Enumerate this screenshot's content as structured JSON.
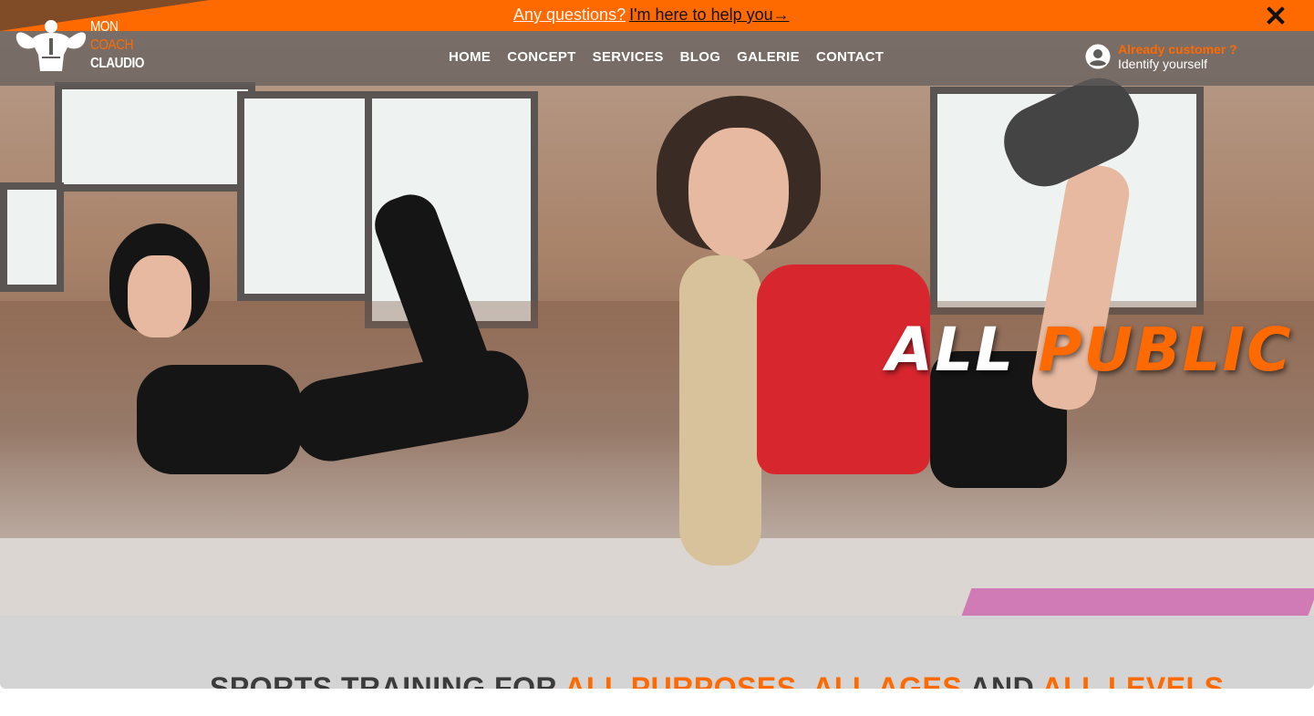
{
  "announcement": {
    "question": "Any questions?",
    "help_link": "I'm here to help you→"
  },
  "logo": {
    "line1": "MON",
    "line2": "COACH",
    "line3": "CLAUDIO"
  },
  "nav": {
    "items": [
      "HOME",
      "CONCEPT",
      "SERVICES",
      "BLOG",
      "GALERIE",
      "CONTACT"
    ]
  },
  "account": {
    "prompt": "Already customer ?",
    "action": "Identify yourself"
  },
  "hero": {
    "headline_white": "ALL",
    "headline_orange": "PUBLIC"
  },
  "tagline": {
    "part1": "SPORTS TRAINING FOR",
    "part2": "ALL PURPOSES, ALL AGES",
    "part3": "AND",
    "part4": "ALL LEVELS"
  },
  "colors": {
    "accent": "#ff6a00",
    "nav_overlay": "#5f5c5a",
    "band": "#d4d4d4"
  },
  "icons": {
    "close": "close-icon",
    "account": "user-circle-icon",
    "logo": "bodybuilder-logo-icon"
  }
}
